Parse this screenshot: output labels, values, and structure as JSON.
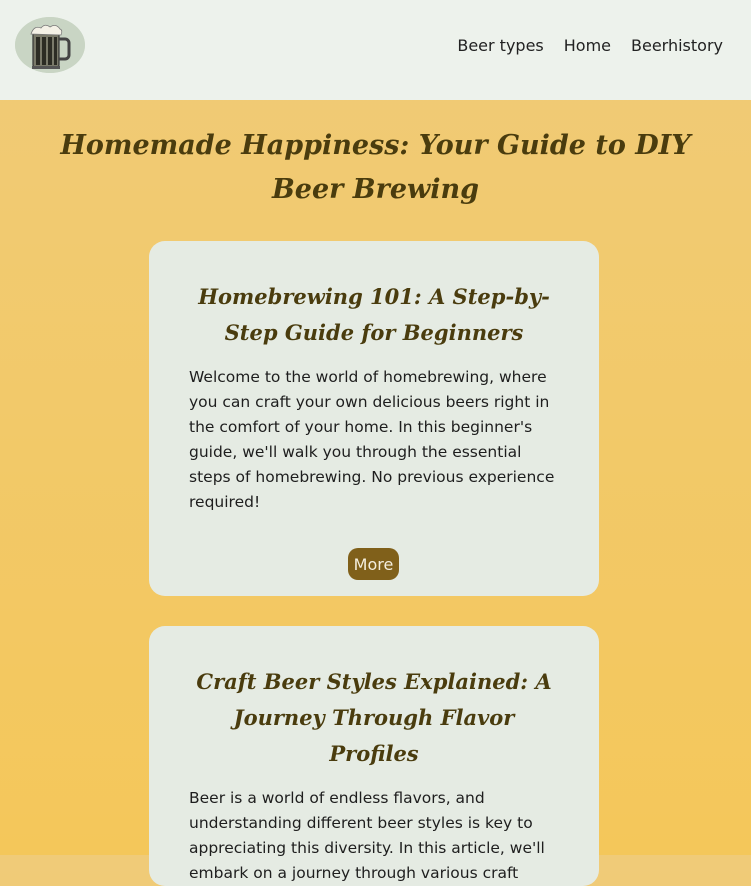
{
  "header": {
    "logo_alt": "beer mug logo",
    "nav": [
      "Beer types",
      "Home",
      "Beerhistory"
    ]
  },
  "main": {
    "title": "Homemade Happiness: Your Guide to DIY Beer Brewing",
    "articles": [
      {
        "title": "Homebrewing 101: A Step-by-Step Guide for Beginners",
        "text": "Welcome to the world of homebrewing, where you can craft your own delicious beers right in the comfort of your home. In this beginner's guide, we'll walk you through the essential steps of homebrewing. No previous experience required!",
        "button": "More"
      },
      {
        "title": "Craft Beer Styles Explained: A Journey Through Flavor Profiles",
        "text": "Beer is a world of endless flavors, and understanding different beer styles is key to appreciating this diversity. In this article, we'll embark on a journey through various craft"
      }
    ]
  },
  "colors": {
    "accent": "#80601a",
    "title": "#4a3c0e",
    "header_bg": "#edf2ec",
    "card_bg": "#e5ebe3"
  }
}
